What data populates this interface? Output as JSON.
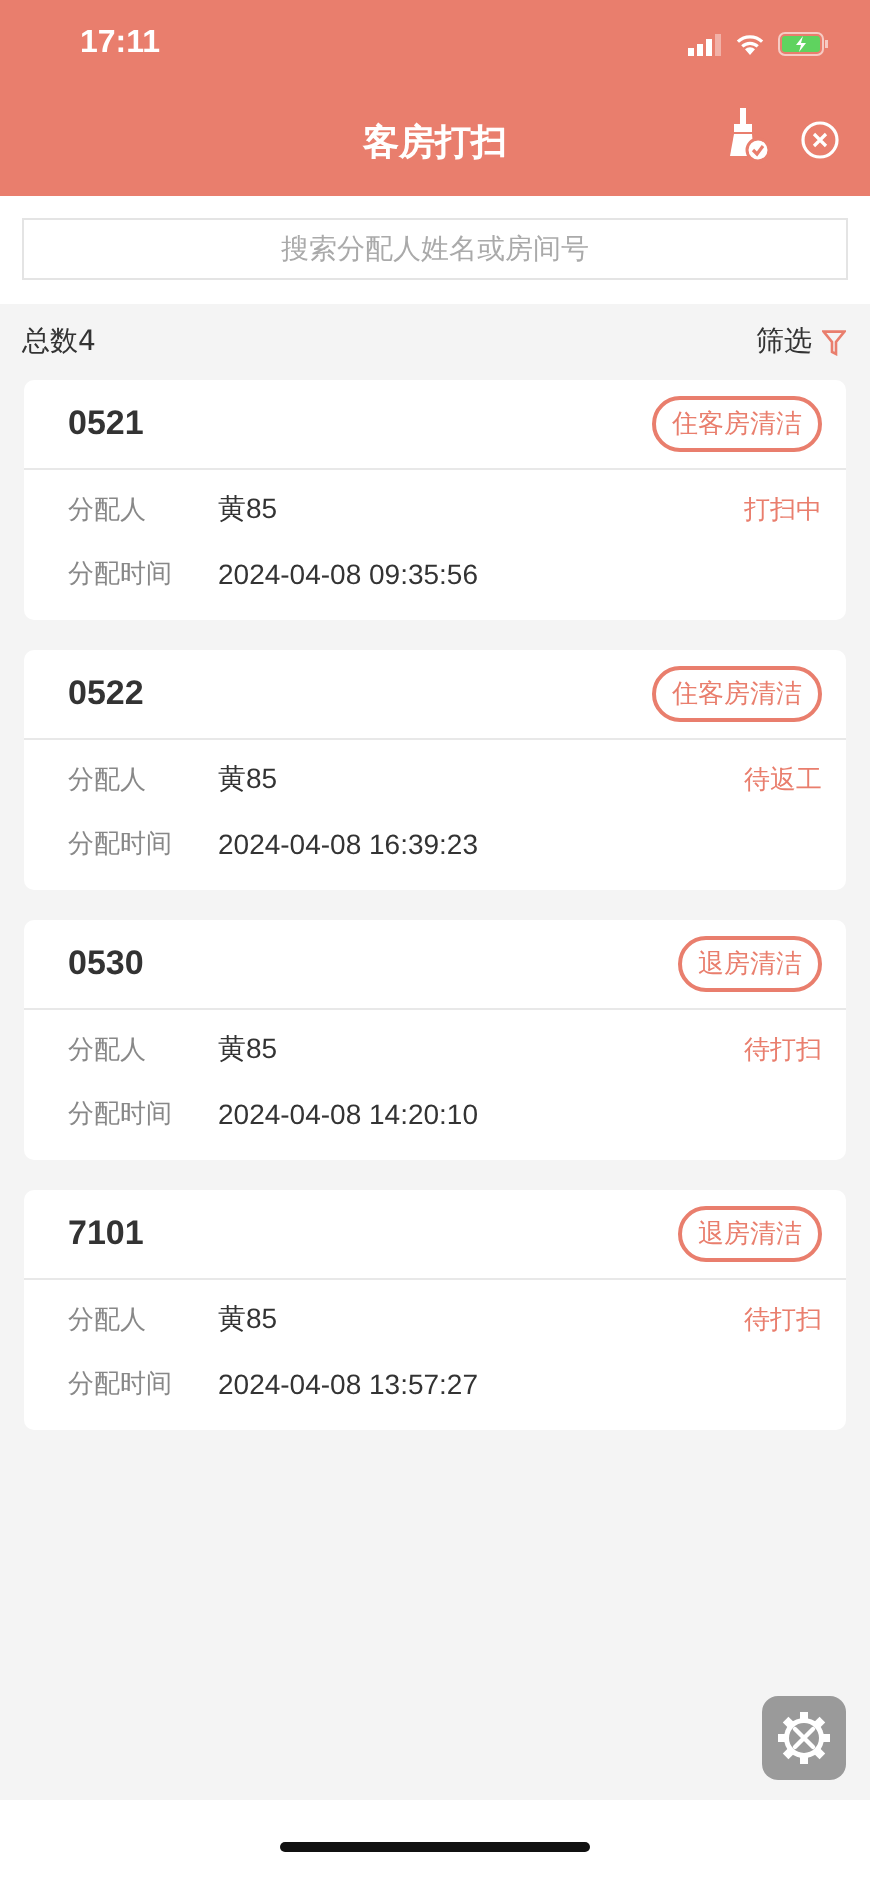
{
  "status_bar": {
    "time": "17:11"
  },
  "header": {
    "title": "客房打扫"
  },
  "search": {
    "placeholder": "搜索分配人姓名或房间号"
  },
  "summary": {
    "total": "总数4",
    "filter": "筛选"
  },
  "rooms": [
    {
      "room": "0521",
      "tag": "住客房清洁",
      "assignee_label": "分配人",
      "assignee": "黄85",
      "status": "打扫中",
      "time_label": "分配时间",
      "time": "2024-04-08 09:35:56"
    },
    {
      "room": "0522",
      "tag": "住客房清洁",
      "assignee_label": "分配人",
      "assignee": "黄85",
      "status": "待返工",
      "time_label": "分配时间",
      "time": "2024-04-08 16:39:23"
    },
    {
      "room": "0530",
      "tag": "退房清洁",
      "assignee_label": "分配人",
      "assignee": "黄85",
      "status": "待打扫",
      "time_label": "分配时间",
      "time": "2024-04-08 14:20:10"
    },
    {
      "room": "7101",
      "tag": "退房清洁",
      "assignee_label": "分配人",
      "assignee": "黄85",
      "status": "待打扫",
      "time_label": "分配时间",
      "time": "2024-04-08 13:57:27"
    }
  ]
}
